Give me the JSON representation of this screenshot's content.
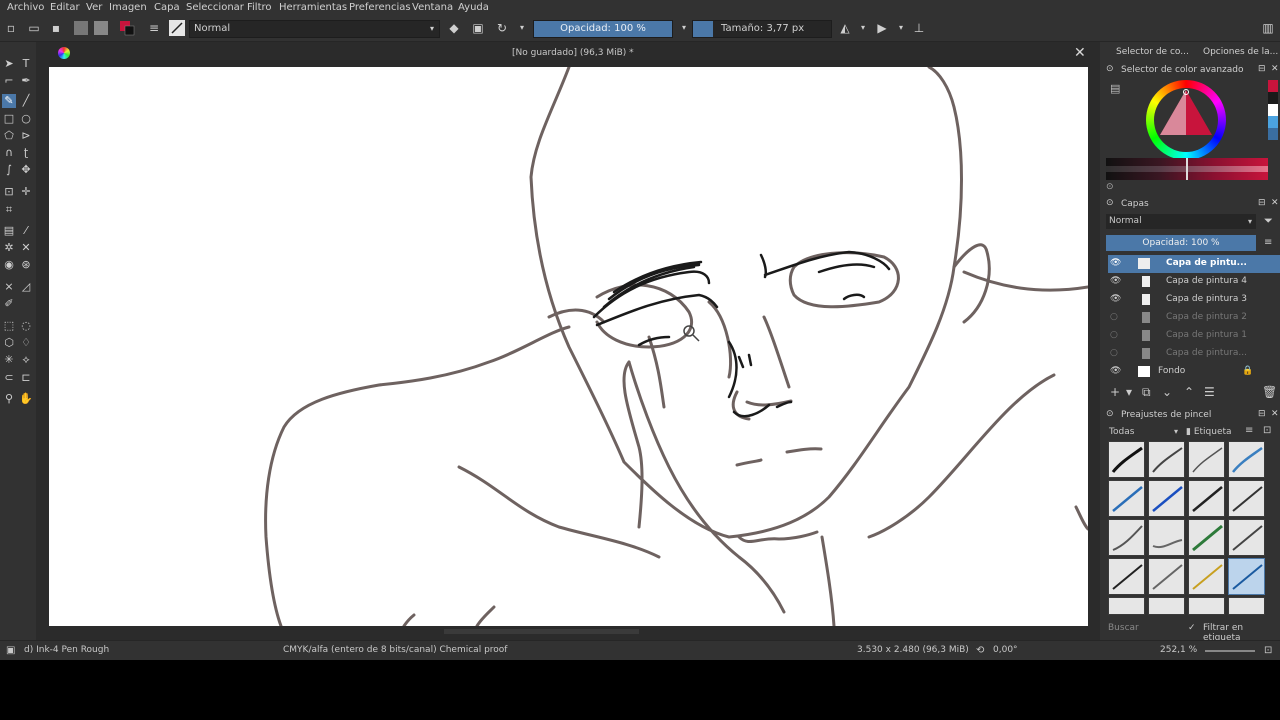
{
  "menu": [
    "Archivo",
    "Editar",
    "Ver",
    "Imagen",
    "Capa",
    "Seleccionar",
    "Filtro",
    "Herramientas",
    "Preferencias",
    "Ventana",
    "Ayuda"
  ],
  "toolbar": {
    "blend_mode": "Normal",
    "opacity": "Opacidad: 100 %",
    "size": "Tamaño: 3,77 px"
  },
  "document": {
    "title": "[No guardado]  (96,3 MiB) *"
  },
  "dock": {
    "tab_color_selector": "Selector de co...",
    "tab_tool_options": "Opciones de la...",
    "color_panel_title": "Selector de color avanzado",
    "layers_title": "Capas",
    "layers_blend": "Normal",
    "layers_opacity": "Opacidad:  100 %",
    "layers": [
      {
        "name": "Capa de pintu...",
        "visible": true,
        "selected": true
      },
      {
        "name": "Capa de pintura 4",
        "visible": true,
        "selected": false
      },
      {
        "name": "Capa de pintura 3",
        "visible": true,
        "selected": false
      },
      {
        "name": "Capa de pintura 2",
        "visible": false,
        "selected": false
      },
      {
        "name": "Capa de pintura 1",
        "visible": false,
        "selected": false
      },
      {
        "name": "Capa de pintura...",
        "visible": false,
        "selected": false
      },
      {
        "name": "Fondo",
        "visible": true,
        "selected": false
      }
    ],
    "presets_title": "Preajustes de pincel",
    "presets_filter": "Todas",
    "presets_tag": "Etiqueta",
    "search_placeholder": "Buscar",
    "filter_in_tag": "Filtrar en etiqueta"
  },
  "status": {
    "brush": "d) Ink-4 Pen Rough",
    "color_profile": "CMYK/alfa (entero de 8 bits/canal)  Chemical proof",
    "dimensions": "3.530 x 2.480 (96,3 MiB)",
    "rotation": "0,00°",
    "zoom": "252,1 %"
  },
  "colors": {
    "accent": "#4b78a8",
    "stroke": "#6e6260",
    "foreground": "#c8143c"
  }
}
